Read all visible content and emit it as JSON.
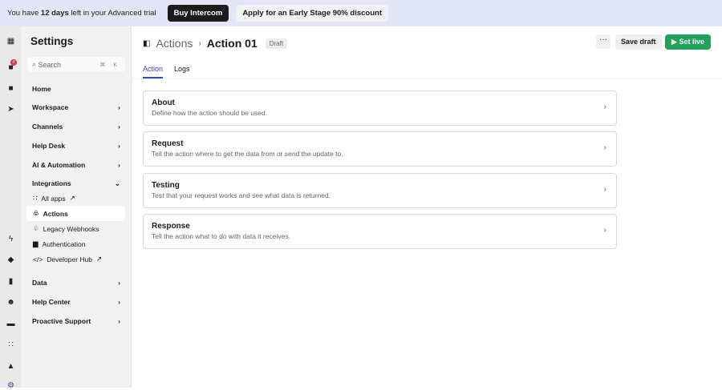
{
  "banner": {
    "pre": "You have ",
    "days": "12 days",
    "post": " left in your Advanced trial",
    "buy": "Buy Intercom",
    "discount": "Apply for an Early Stage 90% discount"
  },
  "rail": {
    "badge": "4"
  },
  "sidebar": {
    "title": "Settings",
    "search_placeholder": "Search",
    "shortcut": "⌘ K",
    "items": [
      {
        "label": "Home"
      },
      {
        "label": "Workspace"
      },
      {
        "label": "Channels"
      },
      {
        "label": "Help Desk"
      },
      {
        "label": "AI & Automation"
      },
      {
        "label": "Integrations"
      }
    ],
    "sub": [
      {
        "label": "All apps"
      },
      {
        "label": "Actions"
      },
      {
        "label": "Legacy Webhooks"
      },
      {
        "label": "Authentication"
      },
      {
        "label": "Developer Hub"
      }
    ],
    "items2": [
      {
        "label": "Data"
      },
      {
        "label": "Help Center"
      },
      {
        "label": "Proactive Support"
      }
    ]
  },
  "header": {
    "crumb": "Actions",
    "title": "Action 01",
    "status": "Draft",
    "more": "···",
    "save": "Save draft",
    "live": "Set live"
  },
  "tabs": [
    {
      "label": "Action"
    },
    {
      "label": "Logs"
    }
  ],
  "cards": [
    {
      "title": "About",
      "desc": "Define how the action should be used."
    },
    {
      "title": "Request",
      "desc": "Tell the action where to get the data from or send the update to."
    },
    {
      "title": "Testing",
      "desc": "Test that your request works and see what data is returned."
    },
    {
      "title": "Response",
      "desc": "Tell the action what to do with data it receives."
    }
  ],
  "colors": {
    "accent": "#3847c7",
    "live": "#1fa35a"
  }
}
